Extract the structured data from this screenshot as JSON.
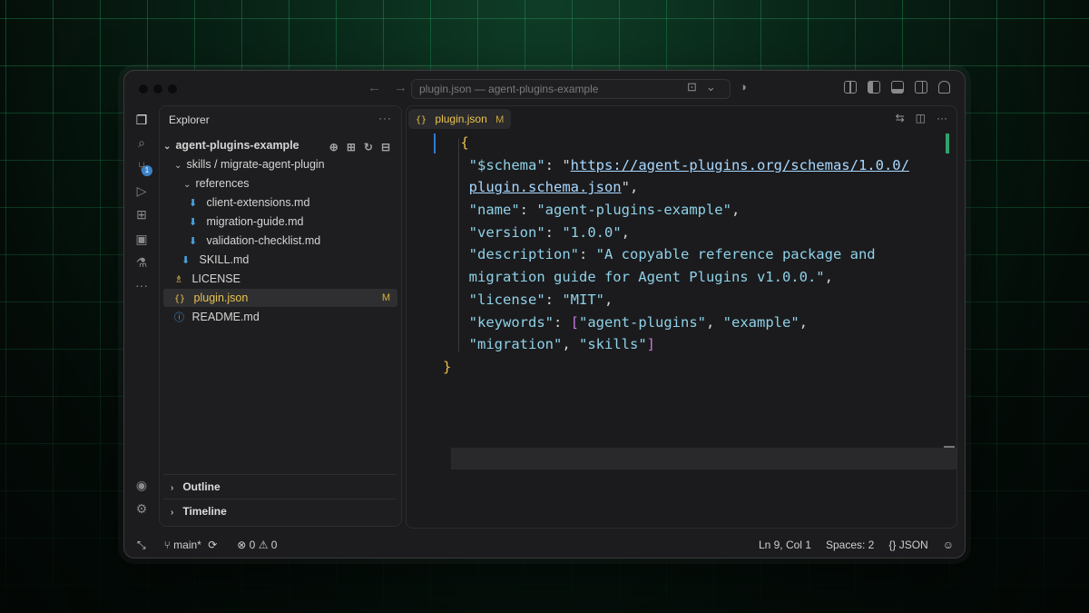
{
  "window": {
    "title": "plugin.json — agent-plugins-example"
  },
  "activity_bar": {
    "scm_badge": "1",
    "more": "···"
  },
  "explorer": {
    "header": "Explorer",
    "more": "···",
    "root": "agent-plugins-example",
    "items": [
      {
        "label": "skills / migrate-agent-plugin",
        "type": "folder"
      },
      {
        "label": "references",
        "type": "folder"
      },
      {
        "label": "client-extensions.md",
        "type": "md"
      },
      {
        "label": "migration-guide.md",
        "type": "md"
      },
      {
        "label": "validation-checklist.md",
        "type": "md"
      },
      {
        "label": "SKILL.md",
        "type": "md"
      },
      {
        "label": "LICENSE",
        "type": "license"
      },
      {
        "label": "plugin.json",
        "type": "json",
        "modified": "M"
      },
      {
        "label": "README.md",
        "type": "info"
      }
    ],
    "json_icon": "{}",
    "sections": {
      "outline": "Outline",
      "timeline": "Timeline"
    }
  },
  "editor": {
    "tab": {
      "icon": "{}",
      "label": "plugin.json",
      "modified": "M"
    },
    "more": "···",
    "code": {
      "open_brace": "{",
      "schema_key": "\"$schema\"",
      "schema_url_1": "https://agent-plugins.org/schemas/1.0.0/",
      "schema_url_2": "plugin.schema.json",
      "name_key": "\"name\"",
      "name_val": "\"agent-plugins-example\"",
      "version_key": "\"version\"",
      "version_val": "\"1.0.0\"",
      "desc_key": "\"description\"",
      "desc_val_1": "\"A copyable reference package and",
      "desc_val_2": "migration guide for Agent Plugins v1.0.0.\"",
      "license_key": "\"license\"",
      "license_val": "\"MIT\"",
      "keywords_key": "\"keywords\"",
      "kw1": "\"agent-plugins\"",
      "kw2": "\"example\"",
      "kw3": "\"migration\"",
      "kw4": "\"skills\"",
      "close_brace": "}"
    }
  },
  "status_bar": {
    "branch": "main*",
    "errors": "0",
    "warnings": "0",
    "position": "Ln 9, Col 1",
    "spaces": "Spaces: 2",
    "language": "JSON",
    "language_icon": "{}"
  },
  "colors": {
    "accent_green": "#2fa36b",
    "badge_blue": "#3b82c6",
    "json_yellow": "#e6c04a",
    "string_cyan": "#8fd1e8"
  }
}
